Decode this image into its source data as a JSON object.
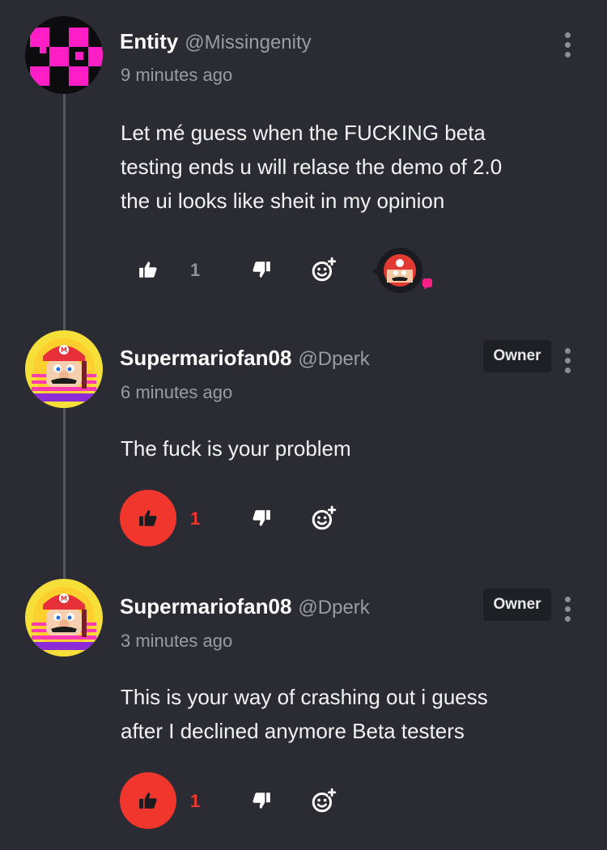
{
  "colors": {
    "background": "#2b2c33",
    "accent": "#f0362d",
    "muted": "#9a9ba3",
    "badge_bg": "#1f2026"
  },
  "comments": [
    {
      "name": "Entity",
      "handle": "@Missingenity",
      "time": "9 minutes ago",
      "text_lines": [
        "Let mé guess when the FUCKING beta",
        "testing ends u will relase the demo of 2.0",
        "the ui looks like sheit in my opinion"
      ],
      "likes": "1",
      "liked": false,
      "owner_badge": ""
    },
    {
      "name": "Supermariofan08",
      "handle": "@Dperk",
      "time": "6 minutes ago",
      "text_lines": [
        "The fuck is your problem"
      ],
      "likes": "1",
      "liked": true,
      "owner_badge": "Owner"
    },
    {
      "name": "Supermariofan08",
      "handle": "@Dperk",
      "time": "3 minutes ago",
      "text_lines": [
        "This is your way of crashing out i guess",
        "after I declined anymore Beta testers"
      ],
      "likes": "1",
      "liked": true,
      "owner_badge": "Owner"
    }
  ],
  "icons": {
    "like": "thumbs-up-icon",
    "dislike": "thumbs-down-icon",
    "react": "add-reaction-icon",
    "more": "kebab-menu-icon"
  }
}
